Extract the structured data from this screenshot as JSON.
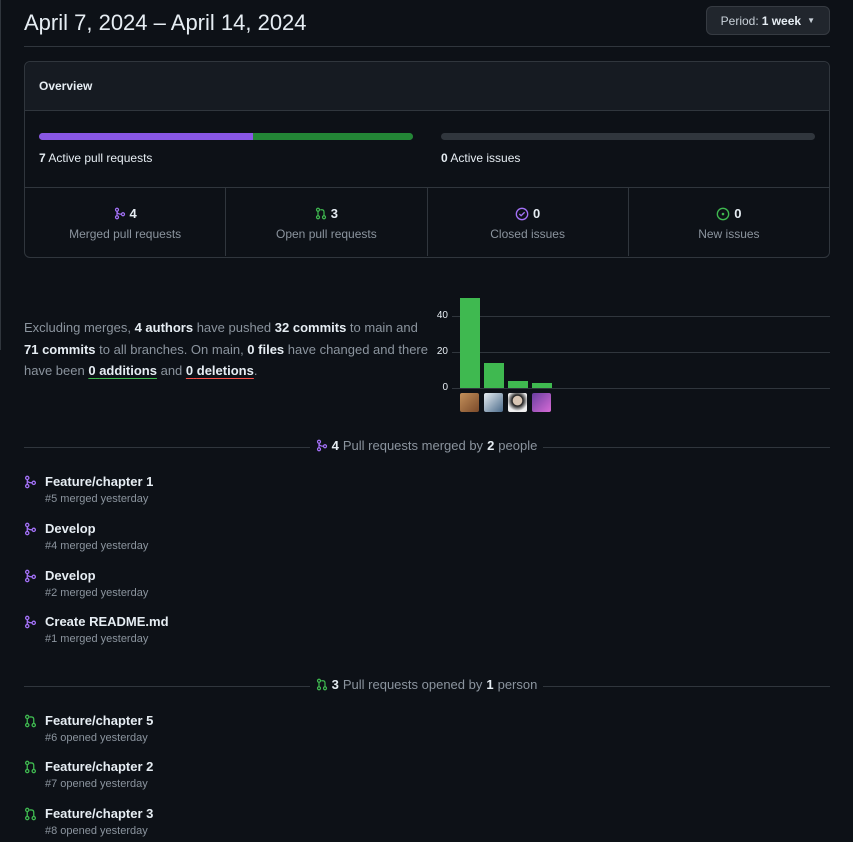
{
  "header": {
    "date_range": "April 7, 2024 – April 14, 2024",
    "period_label": "Period:",
    "period_value": "1 week"
  },
  "overview": {
    "title": "Overview",
    "pull_requests": {
      "count": "7",
      "label": "Active pull requests",
      "merged_fraction": 0.571
    },
    "issues": {
      "count": "0",
      "label": "Active issues"
    },
    "stats": [
      {
        "value": "4",
        "label": "Merged pull requests",
        "icon": "git-merge-icon",
        "color": "#a371f7"
      },
      {
        "value": "3",
        "label": "Open pull requests",
        "icon": "git-pull-request-icon",
        "color": "#3fb950"
      },
      {
        "value": "0",
        "label": "Closed issues",
        "icon": "issue-closed-icon",
        "color": "#a371f7"
      },
      {
        "value": "0",
        "label": "New issues",
        "icon": "issue-opened-icon",
        "color": "#3fb950"
      }
    ]
  },
  "summary": {
    "t1": "Excluding merges, ",
    "authors": "4 authors",
    "t2": " have pushed ",
    "commits_main": "32 commits",
    "t3": " to main and ",
    "commits_all": "71 commits",
    "t4": " to all branches. On main, ",
    "files": "0 files",
    "t5": " have changed and there have been ",
    "additions_num": "0",
    "additions_word": "additions",
    "t6": " and ",
    "deletions_num": "0",
    "deletions_word": "deletions",
    "t7": "."
  },
  "chart_data": {
    "type": "bar",
    "categories": [
      "author-1",
      "author-2",
      "author-3",
      "author-4"
    ],
    "values": [
      50,
      14,
      4,
      3
    ],
    "yticks": [
      "40",
      "20",
      "0"
    ],
    "ylim": [
      0,
      50
    ],
    "bar_color": "#3fb950",
    "grid": true
  },
  "merged_section": {
    "count": "4",
    "label_mid": "Pull requests merged by",
    "people": "2",
    "label_end": "people",
    "items": [
      {
        "title": "Feature/chapter 1",
        "meta": "#5 merged yesterday"
      },
      {
        "title": "Develop",
        "meta": "#4 merged yesterday"
      },
      {
        "title": "Develop",
        "meta": "#2 merged yesterday"
      },
      {
        "title": "Create README.md",
        "meta": "#1 merged yesterday"
      }
    ]
  },
  "opened_section": {
    "count": "3",
    "label_mid": "Pull requests opened by",
    "people": "1",
    "label_end": "person",
    "items": [
      {
        "title": "Feature/chapter 5",
        "meta": "#6 opened yesterday"
      },
      {
        "title": "Feature/chapter 2",
        "meta": "#7 opened yesterday"
      },
      {
        "title": "Feature/chapter 3",
        "meta": "#8 opened yesterday"
      }
    ]
  }
}
